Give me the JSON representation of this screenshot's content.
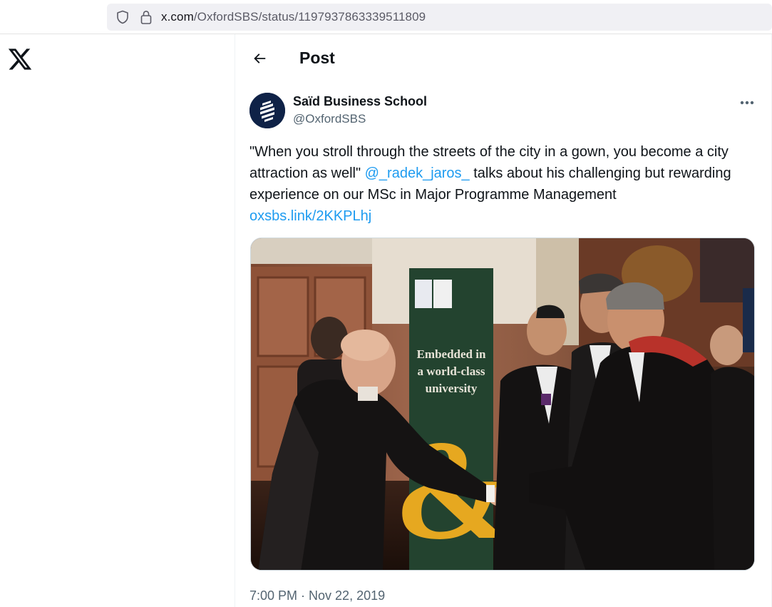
{
  "browser": {
    "url_host": "x.com",
    "url_path": "/OxfordSBS/status/1197937863339511809"
  },
  "nav": {
    "logo_icon": "x-logo-icon"
  },
  "header": {
    "back_icon": "arrow-left-icon",
    "title": "Post"
  },
  "tweet": {
    "author": {
      "display_name": "Saïd Business School",
      "handle": "@OxfordSBS",
      "avatar_color": "#0f2247"
    },
    "text_part1": "\"When you stroll through the streets of the city in a gown, you become a city attraction as well\" ",
    "mention": "@_radek_jaros_",
    "text_part2": " talks about his challenging but rewarding experience on our MSc in Major Programme Management",
    "link": "oxsbs.link/2KKPLhj",
    "media": {
      "banner_line1": "Embedded in",
      "banner_line2": "a world-class",
      "banner_line3": "university"
    },
    "timestamp": "7:00 PM · Nov 22, 2019"
  },
  "colors": {
    "link": "#1d9bf0",
    "secondary_text": "#536471",
    "primary_text": "#0f1419"
  }
}
